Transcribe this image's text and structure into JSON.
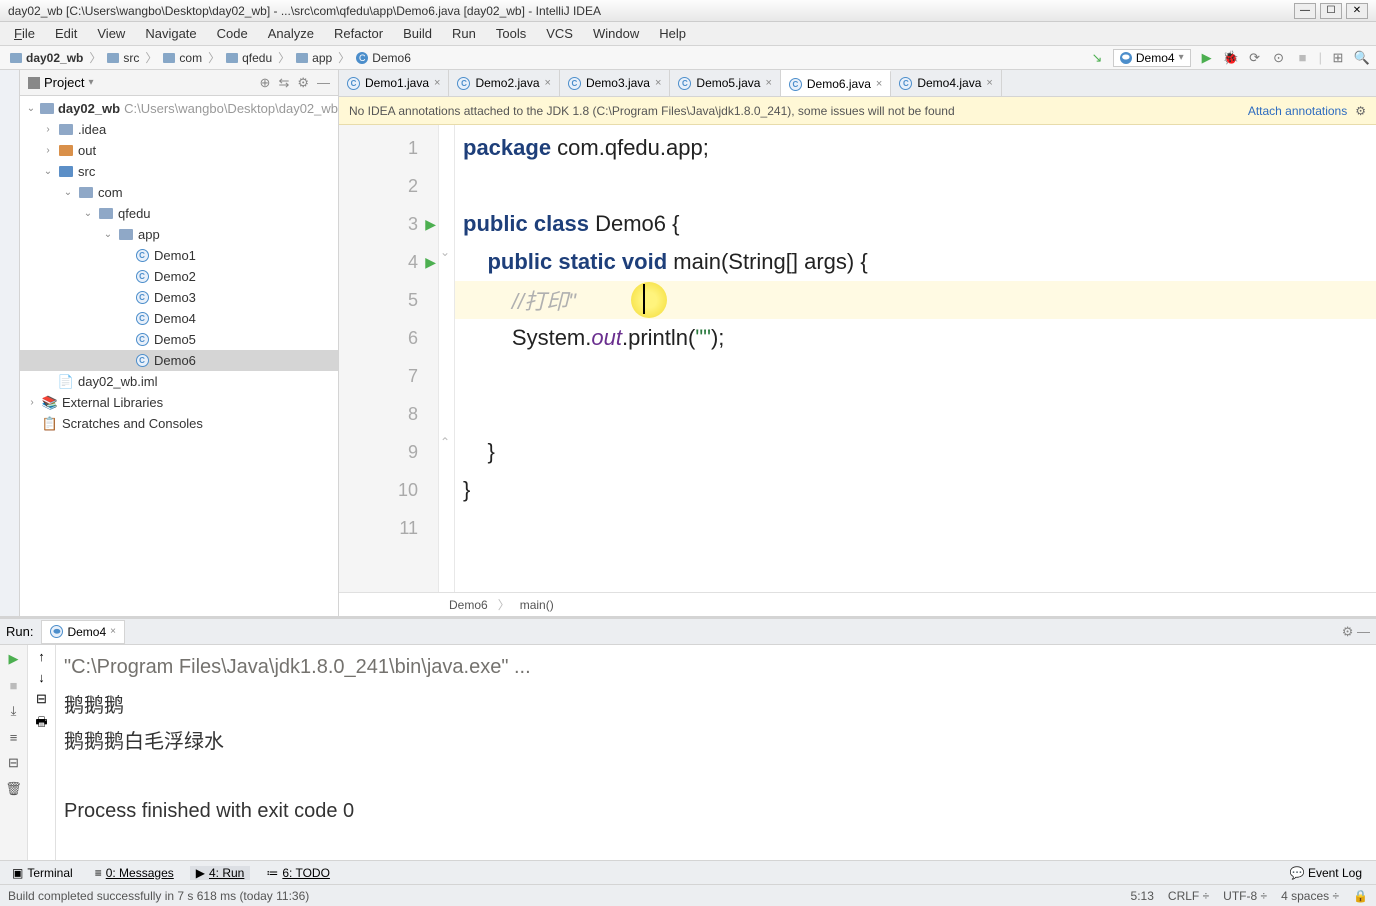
{
  "title": "day02_wb [C:\\Users\\wangbo\\Desktop\\day02_wb] - ...\\src\\com\\qfedu\\app\\Demo6.java [day02_wb] - IntelliJ IDEA",
  "menus": [
    "File",
    "Edit",
    "View",
    "Navigate",
    "Code",
    "Analyze",
    "Refactor",
    "Build",
    "Run",
    "Tools",
    "VCS",
    "Window",
    "Help"
  ],
  "breadcrumbs": [
    "day02_wb",
    "src",
    "com",
    "qfedu",
    "app",
    "Demo6"
  ],
  "run_config": "Demo4",
  "project_panel_title": "Project",
  "tree": {
    "root": "day02_wb",
    "root_path": "C:\\Users\\wangbo\\Desktop\\day02_wb",
    "idea": ".idea",
    "out": "out",
    "src": "src",
    "com": "com",
    "qfedu": "qfedu",
    "app": "app",
    "demos": [
      "Demo1",
      "Demo2",
      "Demo3",
      "Demo4",
      "Demo5",
      "Demo6"
    ],
    "iml": "day02_wb.iml",
    "ext_lib": "External Libraries",
    "scratches": "Scratches and Consoles"
  },
  "tabs": [
    {
      "label": "Demo1.java"
    },
    {
      "label": "Demo2.java"
    },
    {
      "label": "Demo3.java"
    },
    {
      "label": "Demo5.java"
    },
    {
      "label": "Demo6.java",
      "active": true
    },
    {
      "label": "Demo4.java"
    }
  ],
  "notice": "No IDEA annotations attached to the JDK 1.8 (C:\\Program Files\\Java\\jdk1.8.0_241), some issues will not be found",
  "notice_link": "Attach annotations",
  "code": {
    "l1": {
      "pkg": "package",
      "rest": " com.qfedu.app;"
    },
    "l3": {
      "kw1": "public class",
      "name": " Demo6 {"
    },
    "l4": {
      "kw": "public static void",
      "sig": " main(String[] args) {"
    },
    "l5": "//打印\"",
    "l6": {
      "p1": "System.",
      "out": "out",
      "p2": ".println(",
      "s": "\"\"",
      "p3": ");"
    },
    "l9": "    }",
    "l10": "}"
  },
  "breadcrumb_bottom": [
    "Demo6",
    "main()"
  ],
  "run_header": "Run:",
  "run_tab": "Demo4",
  "console_lines": [
    "\"C:\\Program Files\\Java\\jdk1.8.0_241\\bin\\java.exe\" ...",
    "鹅鹅鹅",
    "鹅鹅鹅白毛浮绿水",
    "",
    "Process finished with exit code 0"
  ],
  "bottom_tools": {
    "terminal": "Terminal",
    "messages": "0: Messages",
    "run": "4: Run",
    "todo": "6: TODO",
    "event_log": "Event Log"
  },
  "status": {
    "msg": "Build completed successfully in 7 s 618 ms (today 11:36)",
    "pos": "5:13",
    "le": "CRLF",
    "enc": "UTF-8",
    "indent": "4 spaces"
  }
}
